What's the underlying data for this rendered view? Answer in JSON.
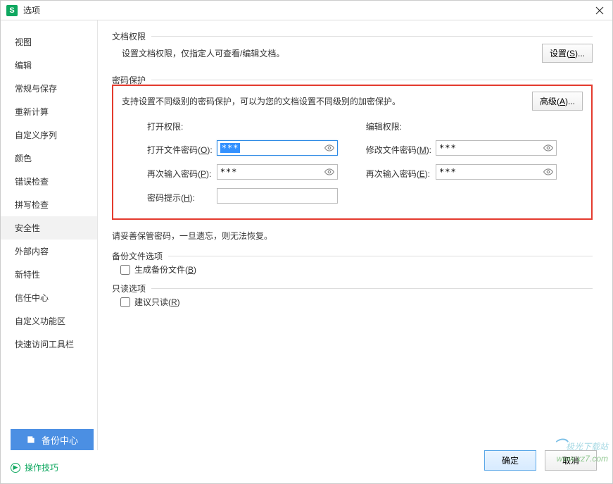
{
  "titlebar": {
    "title": "选项",
    "icon_text": "S"
  },
  "sidebar": {
    "items": [
      "视图",
      "编辑",
      "常规与保存",
      "重新计算",
      "自定义序列",
      "颜色",
      "错误检查",
      "拼写检查",
      "安全性",
      "外部内容",
      "新特性",
      "信任中心",
      "自定义功能区",
      "快速访问工具栏"
    ],
    "active_index": 8
  },
  "doc_permission": {
    "legend": "文档权限",
    "text": "设置文档权限，仅指定人可查看/编辑文档。",
    "button": "设置(S)..."
  },
  "password_protection": {
    "legend": "密码保护",
    "desc": "支持设置不同级别的密码保护，可以为您的文档设置不同级别的加密保护。",
    "advanced_btn": "高级(A)...",
    "open_perm_title": "打开权限:",
    "open_pwd_label": "打开文件密码(O):",
    "open_pwd_value": "***",
    "open_pwd_confirm_label": "再次输入密码(P):",
    "open_pwd_confirm_value": "***",
    "hint_label": "密码提示(H):",
    "hint_value": "",
    "edit_perm_title": "编辑权限:",
    "edit_pwd_label": "修改文件密码(M):",
    "edit_pwd_value": "***",
    "edit_pwd_confirm_label": "再次输入密码(E):",
    "edit_pwd_confirm_value": "***"
  },
  "warning": "请妥善保管密码，一旦遗忘，则无法恢复。",
  "backup_options": {
    "legend": "备份文件选项",
    "generate_backup": "生成备份文件(B)"
  },
  "readonly_options": {
    "legend": "只读选项",
    "suggest_readonly": "建议只读(R)"
  },
  "backup_center": "备份中心",
  "tips": "操作技巧",
  "footer": {
    "ok": "确定",
    "cancel": "取消"
  },
  "watermark": {
    "line1": "极光下载站",
    "line2": "www.xz7.com"
  }
}
